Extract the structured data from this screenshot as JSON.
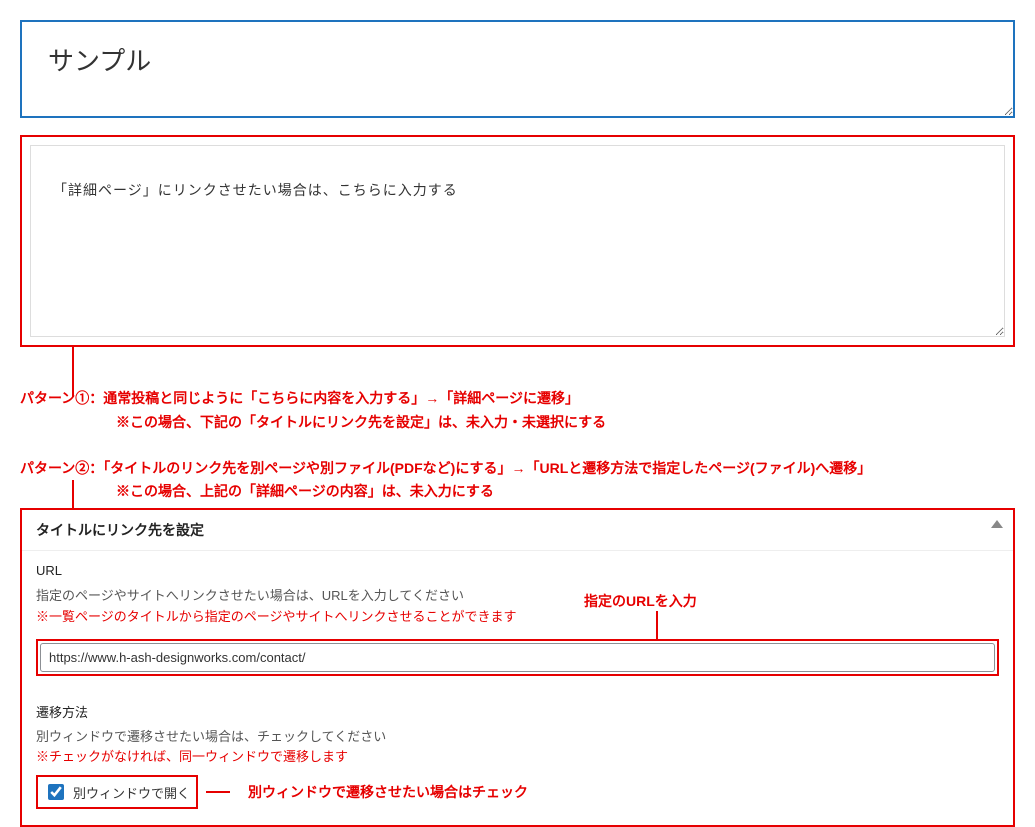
{
  "title_box": {
    "value": "サンプル"
  },
  "content_box": {
    "text": "「詳細ページ」にリンクさせたい場合は、こちらに入力する"
  },
  "pattern1": {
    "line1": "パターン①：通常投稿と同じように「こちらに内容を入力する」→「詳細ページに遷移」",
    "line2": "※この場合、下記の「タイトルにリンク先を設定」は、未入力・未選択にする"
  },
  "pattern2": {
    "line1": "パターン②：「タイトルのリンク先を別ページや別ファイル(PDFなど)にする」→「URLと遷移方法で指定したページ(ファイル)へ遷移」",
    "line2": "※この場合、上記の「詳細ページの内容」は、未入力にする"
  },
  "panel": {
    "header": "タイトルにリンク先を設定",
    "url_section": {
      "label": "URL",
      "desc": "指定のページやサイトへリンクさせたい場合は、URLを入力してください",
      "note": "※一覧ページのタイトルから指定のページやサイトへリンクさせることができます",
      "value": "https://www.h-ash-designworks.com/contact/",
      "annotation": "指定のURLを入力"
    },
    "transition_section": {
      "label": "遷移方法",
      "desc": "別ウィンドウで遷移させたい場合は、チェックしてください",
      "note": "※チェックがなければ、同一ウィンドウで遷移します",
      "checkbox_label": "別ウィンドウで開く",
      "checkbox_checked": true,
      "annotation": "別ウィンドウで遷移させたい場合はチェック"
    }
  }
}
